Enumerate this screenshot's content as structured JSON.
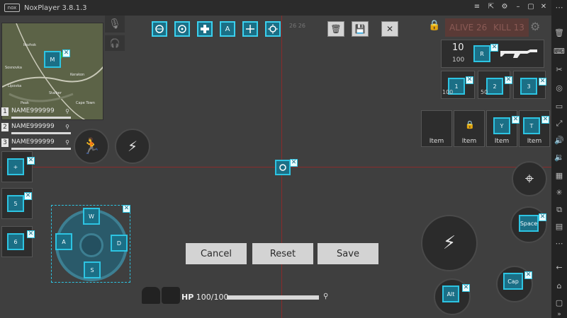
{
  "window": {
    "app_name": "NoxPlayer 3.8.1.3",
    "logo_text": "nox"
  },
  "titlebar_buttons": [
    "menu-icon",
    "pin-icon",
    "settings-icon",
    "minimize-icon",
    "maximize-icon",
    "close-icon"
  ],
  "toolbar": {
    "keys": [
      {
        "name": "aim-key",
        "label": ""
      },
      {
        "name": "view-key",
        "label": ""
      },
      {
        "name": "dpad-key",
        "label": ""
      },
      {
        "name": "a-key",
        "label": "A"
      },
      {
        "name": "crosshair-key",
        "label": ""
      },
      {
        "name": "target-key",
        "label": ""
      }
    ],
    "delete_icon": "trash-icon",
    "save_icon": "save-icon",
    "close_icon": "close-icon"
  },
  "minimap": {
    "labels": [
      "Rozhok",
      "Kerakon",
      "Sosnovka",
      "Peak",
      "Lipovka",
      "Cape Town",
      "Stalber"
    ],
    "key_label": "M"
  },
  "players": [
    {
      "num": "1",
      "name": "NAME999999"
    },
    {
      "num": "2",
      "name": "NAME999999"
    },
    {
      "num": "3",
      "name": "NAME999999"
    }
  ],
  "stats": {
    "alive": "ALIVE 26",
    "kill": "KILL 13",
    "numbers": "26  26"
  },
  "weapon": {
    "ammo": "10",
    "reserve": "100",
    "key": "R"
  },
  "slots": [
    {
      "key": "1",
      "count": "100"
    },
    {
      "key": "2",
      "count": "50"
    },
    {
      "key": "3",
      "count": ""
    }
  ],
  "items": [
    {
      "label": "Item",
      "key": ""
    },
    {
      "label": "Item",
      "key": ""
    },
    {
      "label": "Item",
      "key": "Y"
    },
    {
      "label": "Item",
      "key": "T"
    }
  ],
  "left_keys": [
    "+",
    "5",
    "6"
  ],
  "dpad": {
    "up": "W",
    "left": "A",
    "right": "D",
    "down": "S"
  },
  "right_keys": {
    "space": "Space",
    "cap": "Cap",
    "alt": "Alt"
  },
  "buttons": {
    "cancel": "Cancel",
    "reset": "Reset",
    "save": "Save"
  },
  "hp": {
    "label": "HP",
    "value": "100/100"
  },
  "colors": {
    "accent": "#2dc4e2",
    "key_bg": "#1b6f86",
    "crosshair": "#8a2b2b"
  }
}
